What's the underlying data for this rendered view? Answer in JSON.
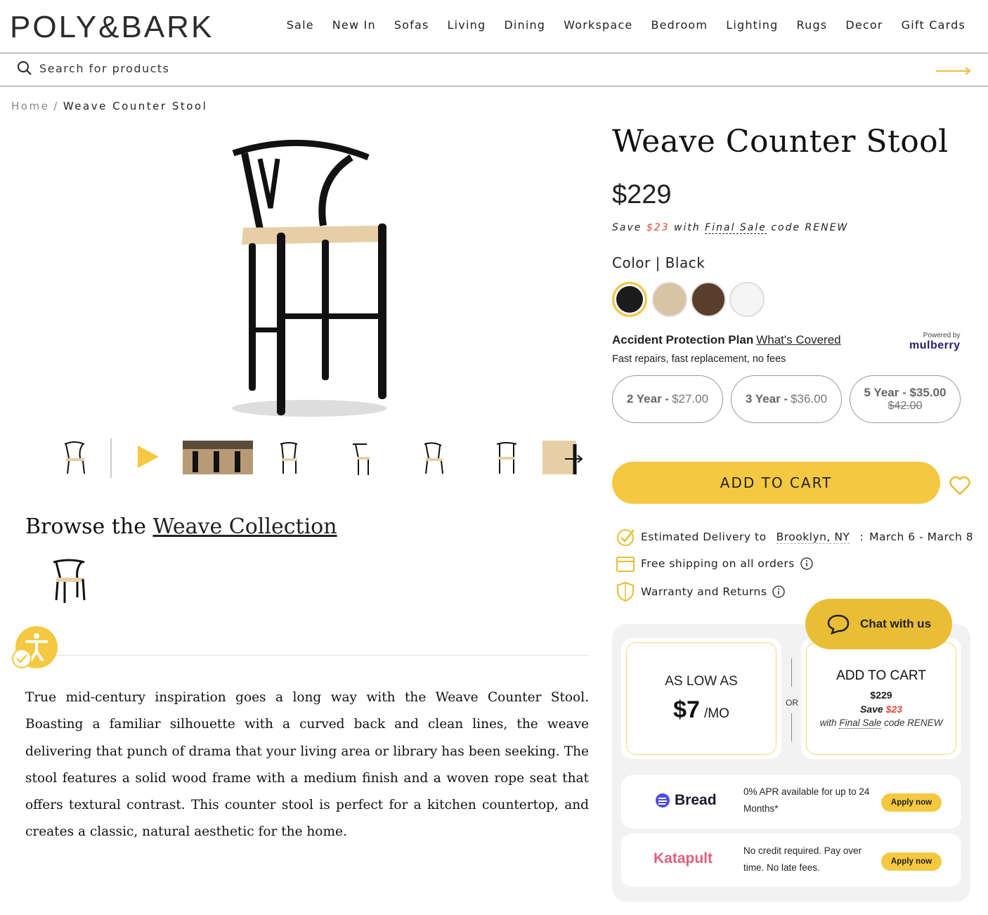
{
  "brand": {
    "logo": "POLY&BARK"
  },
  "nav": [
    "Sale",
    "New In",
    "Sofas",
    "Living",
    "Dining",
    "Workspace",
    "Bedroom",
    "Lighting",
    "Rugs",
    "Decor",
    "Gift Cards"
  ],
  "search": {
    "placeholder": "Search for products"
  },
  "breadcrumb": {
    "home": "Home",
    "sep": "/",
    "current": "Weave Counter Stool"
  },
  "product": {
    "title": "Weave Counter Stool",
    "price": "$229",
    "save": {
      "prefix": "Save",
      "amount": "$23",
      "with": "with",
      "code_label": "Final Sale",
      "suffix": "code RENEW"
    },
    "color_label": "Color | Black",
    "swatches": [
      "#1c1c1c",
      "#d9c3a5",
      "#5b3d2c",
      "#f5f5f5"
    ],
    "swatch_names": [
      "black-swatch",
      "natural-swatch",
      "walnut-swatch",
      "white-swatch"
    ]
  },
  "protection": {
    "title": "Accident Protection Plan",
    "link": "What's Covered",
    "sub": "Fast repairs, fast replacement, no fees",
    "powered": "Powered by",
    "provider": "mulberry",
    "plans": [
      {
        "term": "2 Year -",
        "price": "$27.00",
        "old": ""
      },
      {
        "term": "3 Year -",
        "price": "$36.00",
        "old": ""
      },
      {
        "term": "5 Year - $35.00",
        "price": "",
        "old": "$42.00"
      }
    ]
  },
  "cart": {
    "add_to_cart": "ADD TO CART"
  },
  "delivery": {
    "estimated": "Estimated Delivery to",
    "location": "Brooklyn, NY",
    "colon": ":",
    "dates": "March 6 - March 8",
    "shipping": "Free shipping on all orders",
    "warranty": "Warranty and Returns"
  },
  "chat": {
    "label": "Chat with us"
  },
  "finance": {
    "as_low_as": "AS LOW AS",
    "monthly": "$7",
    "per": "/MO",
    "or": "OR",
    "atc": "ADD TO CART",
    "atc_price": "$229",
    "save_prefix": "Save",
    "save_amount": "$23",
    "with": "with",
    "code_label": "Final Sale",
    "code_suffix": "code RENEW",
    "lenders": [
      {
        "name": "Bread",
        "text": "0% APR available for up to 24 Months*",
        "cta": "Apply now",
        "color": "#1a1a2e"
      },
      {
        "name": "Katapult",
        "text": "No credit required. Pay over time. No late fees.",
        "cta": "Apply now",
        "color": "#e0607e"
      }
    ]
  },
  "browse": {
    "prefix": "Browse the",
    "link": "Weave Collection"
  },
  "description": "True mid-century inspiration goes a long way with the Weave Counter Stool. Boasting a familiar silhouette with a curved back and clean lines, the weave delivering that punch of drama that your living area or library has been seeking. The stool features a solid wood frame with a medium finish and a woven rope seat that offers textural contrast. This counter stool is perfect for a kitchen countertop, and creates a classic, natural aesthetic for the home.",
  "colors": {
    "accent": "#f5c842",
    "sale_red": "#e04a3b",
    "chat": "#e9bd36"
  }
}
